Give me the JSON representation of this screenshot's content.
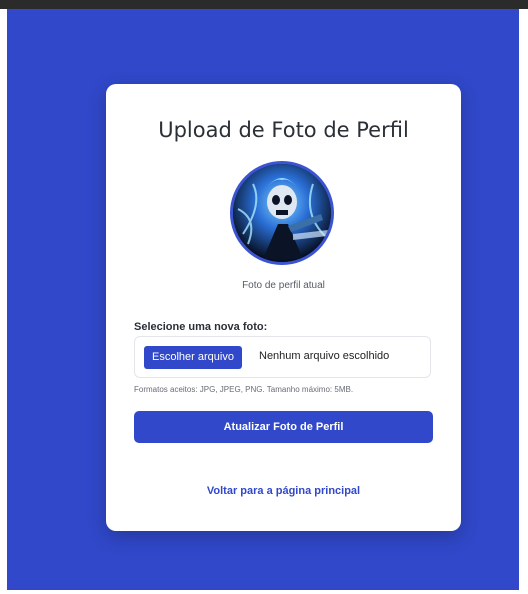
{
  "page": {
    "background_color": "#3048c9",
    "accent_color": "#3048c9"
  },
  "card": {
    "title": "Upload de Foto de Perfil",
    "avatar_icon": "profile-photo-ghost-rider",
    "avatar_caption": "Foto de perfil atual",
    "file_label": "Selecione uma nova foto:",
    "file_button_label": "Escolher arquivo",
    "file_status": "Nenhum arquivo escolhido",
    "formats_note": "Formatos aceitos: JPG, JPEG, PNG. Tamanho máximo: 5MB.",
    "submit_label": "Atualizar Foto de Perfil",
    "back_link": "Voltar para a página principal"
  }
}
